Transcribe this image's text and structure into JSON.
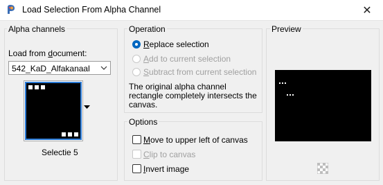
{
  "window": {
    "title": "Load Selection From Alpha Channel",
    "close_glyph": "✕"
  },
  "alpha": {
    "group_title": "Alpha channels",
    "load_label_pre": "Load from ",
    "load_label_u": "d",
    "load_label_post": "ocument:",
    "document_value": "542_KaD_Alfakanaal",
    "selection_caption": "Selectie 5"
  },
  "operation": {
    "group_title": "Operation",
    "options": [
      {
        "u": "R",
        "rest": "eplace selection",
        "selected": true,
        "enabled": true
      },
      {
        "u": "A",
        "rest": "dd to current selection",
        "selected": false,
        "enabled": false
      },
      {
        "u": "S",
        "rest": "ubtract from current selection",
        "selected": false,
        "enabled": false
      }
    ],
    "description": "The original alpha channel rectangle completely intersects the canvas."
  },
  "options": {
    "group_title": "Options",
    "items": [
      {
        "u": "M",
        "rest": "ove to upper left of canvas",
        "checked": false,
        "enabled": true
      },
      {
        "u": "C",
        "rest": "lip to canvas",
        "checked": false,
        "enabled": false
      },
      {
        "u": "I",
        "rest": "nvert image",
        "checked": false,
        "enabled": true
      }
    ]
  },
  "preview": {
    "group_title": "Preview"
  },
  "colors": {
    "accent": "#0067c0",
    "thumb_outline": "#2a7ad6"
  }
}
